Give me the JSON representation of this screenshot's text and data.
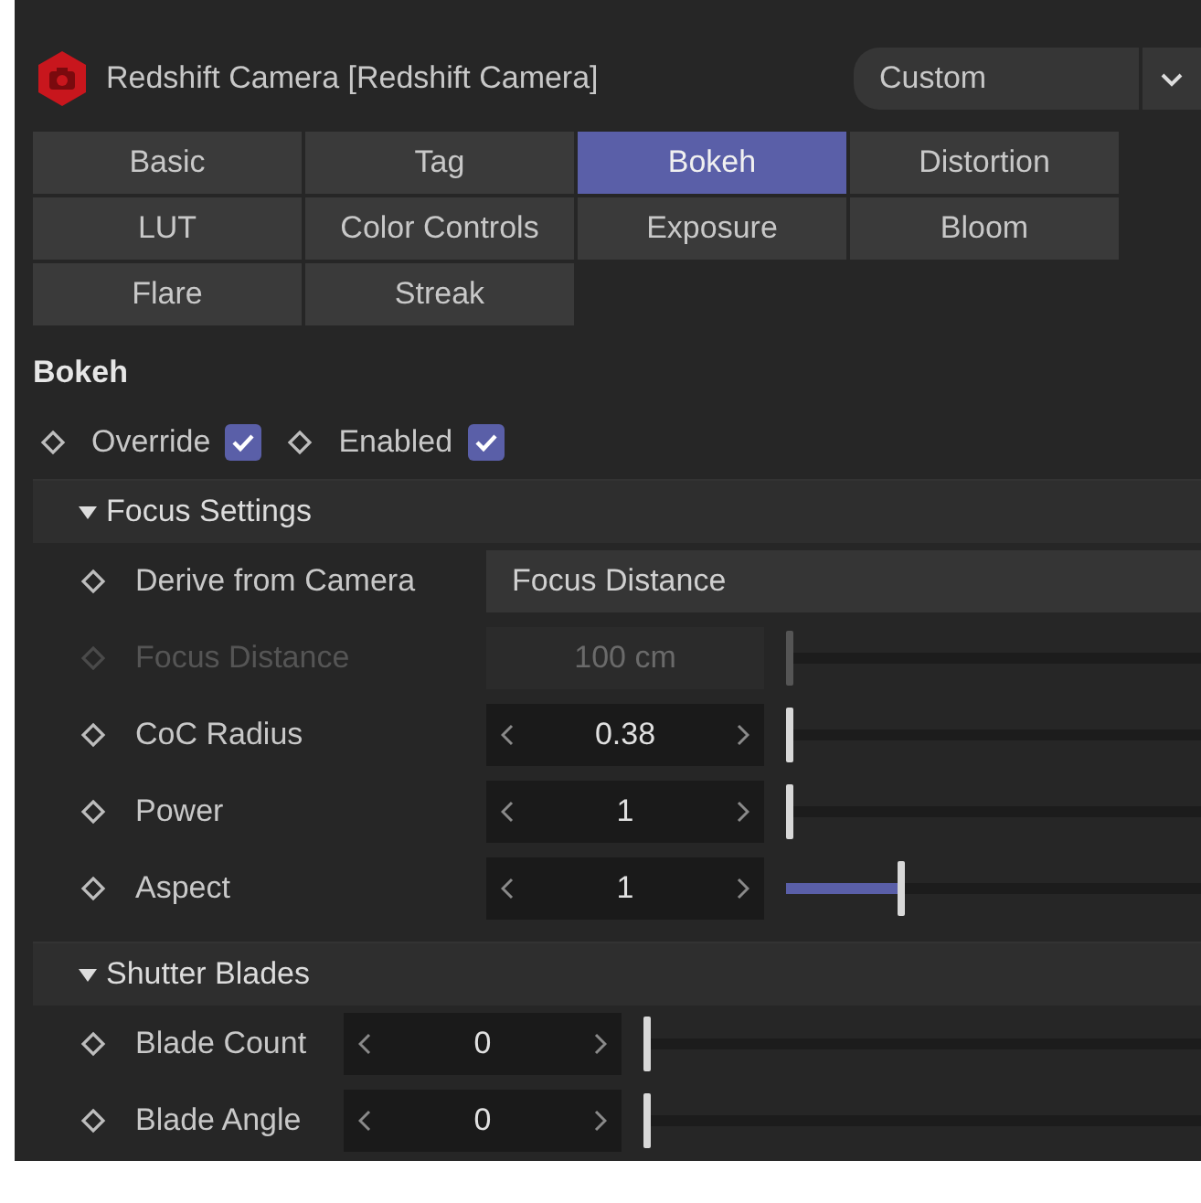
{
  "header": {
    "title": "Redshift Camera [Redshift Camera]",
    "preset": "Custom"
  },
  "tabs": [
    {
      "label": "Basic",
      "selected": false
    },
    {
      "label": "Tag",
      "selected": false
    },
    {
      "label": "Bokeh",
      "selected": true
    },
    {
      "label": "Distortion",
      "selected": false
    },
    {
      "label": "LUT",
      "selected": false
    },
    {
      "label": "Color Controls",
      "selected": false
    },
    {
      "label": "Exposure",
      "selected": false
    },
    {
      "label": "Bloom",
      "selected": false
    },
    {
      "label": "Flare",
      "selected": false
    },
    {
      "label": "Streak",
      "selected": false
    }
  ],
  "section_title": "Bokeh",
  "toggles": [
    {
      "label": "Override",
      "checked": true
    },
    {
      "label": "Enabled",
      "checked": true
    }
  ],
  "groups": [
    {
      "title": "Focus Settings",
      "expanded": true,
      "rows": [
        {
          "kind": "dropdown",
          "label": "Derive from Camera",
          "value": "Focus Distance",
          "disabled": false
        },
        {
          "kind": "number",
          "label": "Focus Distance",
          "value": "100 cm",
          "disabled": true,
          "level": 0
        },
        {
          "kind": "number",
          "label": "CoC Radius",
          "value": "0.38",
          "disabled": false,
          "level": 0
        },
        {
          "kind": "number",
          "label": "Power",
          "value": "1",
          "disabled": false,
          "level": 0
        },
        {
          "kind": "number",
          "label": "Aspect",
          "value": "1",
          "disabled": false,
          "level": 0.27
        }
      ]
    },
    {
      "title": "Shutter Blades",
      "expanded": true,
      "rows": [
        {
          "kind": "number",
          "label": "Blade Count",
          "value": "0",
          "disabled": false,
          "level": 0
        },
        {
          "kind": "number",
          "label": "Blade Angle",
          "value": "0",
          "disabled": false,
          "level": 0
        }
      ]
    }
  ]
}
